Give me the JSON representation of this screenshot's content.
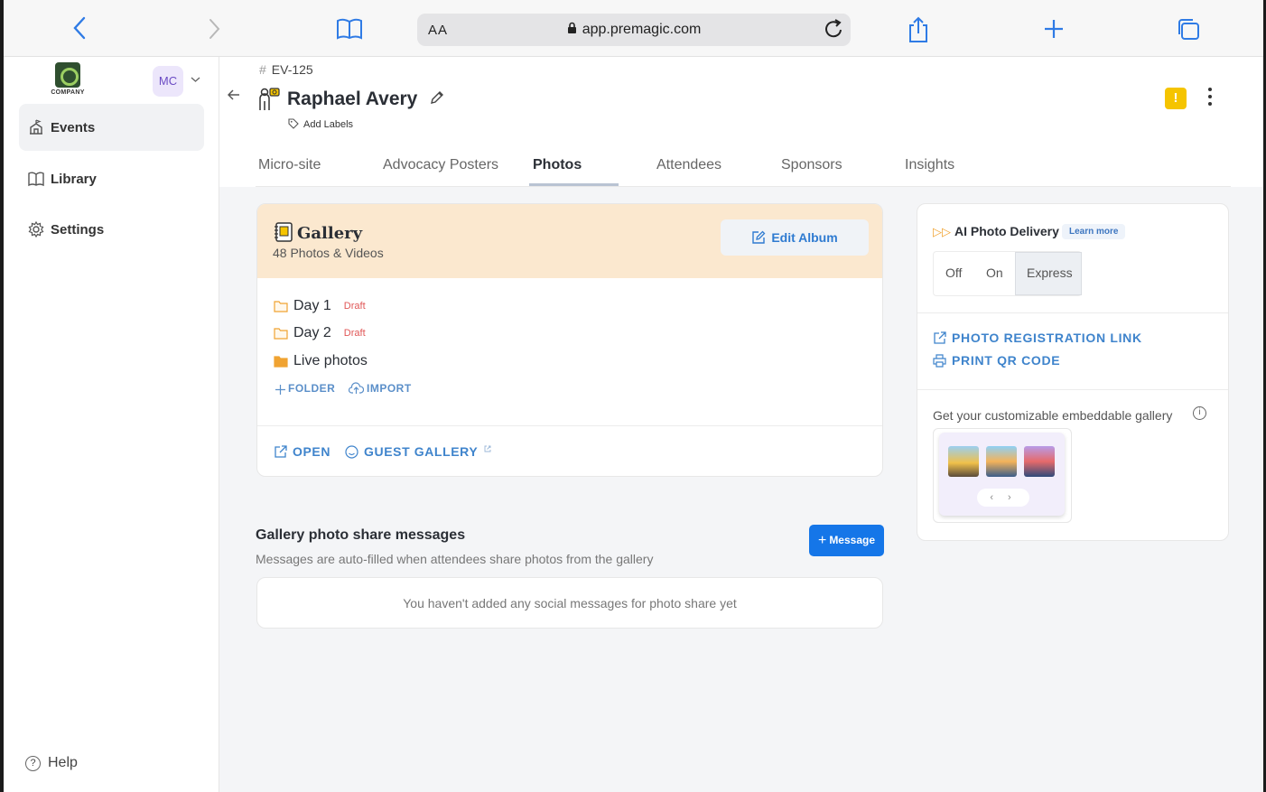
{
  "browser": {
    "aa_label": "AA",
    "url": "app.premagic.com"
  },
  "sidebar": {
    "logo_text": "COMPANY",
    "avatar_initials": "MC",
    "items": [
      {
        "label": "Events",
        "icon": "events-icon",
        "active": true
      },
      {
        "label": "Library",
        "icon": "book-icon",
        "active": false
      },
      {
        "label": "Settings",
        "icon": "gear-icon",
        "active": false
      }
    ],
    "help_label": "Help"
  },
  "header": {
    "event_id": "EV-125",
    "event_name": "Raphael Avery",
    "add_labels": "Add Labels",
    "warning_badge": "!",
    "tabs": [
      {
        "label": "Micro-site"
      },
      {
        "label": "Advocacy Posters"
      },
      {
        "label": "Photos",
        "active": true
      },
      {
        "label": "Attendees"
      },
      {
        "label": "Sponsors"
      },
      {
        "label": "Insights"
      }
    ]
  },
  "gallery": {
    "title": "Gallery",
    "subtitle": "48 Photos & Videos",
    "edit_album_label": "Edit Album",
    "folders": [
      {
        "name": "Day 1",
        "status": "Draft"
      },
      {
        "name": "Day 2",
        "status": "Draft"
      },
      {
        "name": "Live photos",
        "status": ""
      }
    ],
    "folder_action": "FOLDER",
    "import_action": "IMPORT",
    "open_label": "OPEN",
    "guest_gallery_label": "GUEST GALLERY"
  },
  "messages": {
    "title": "Gallery photo share messages",
    "subtitle": "Messages are auto-filled when attendees share photos from the gallery",
    "button_label": "Message",
    "empty_text": "You haven't added any social messages for photo share yet"
  },
  "ai_delivery": {
    "title": "AI Photo Delivery",
    "learn_more": "Learn more",
    "options": [
      "Off",
      "On",
      "Express"
    ],
    "selected": "Express",
    "registration_link": "PHOTO REGISTRATION LINK",
    "print_qr": "PRINT QR CODE",
    "embed_text": "Get your customizable embeddable gallery",
    "info_glyph": "i"
  },
  "colors": {
    "accent": "#1576e8",
    "link": "#3f84cc",
    "gallery_header_bg": "#fbe8cf",
    "draft": "#e05757",
    "warning": "#f5c400"
  }
}
